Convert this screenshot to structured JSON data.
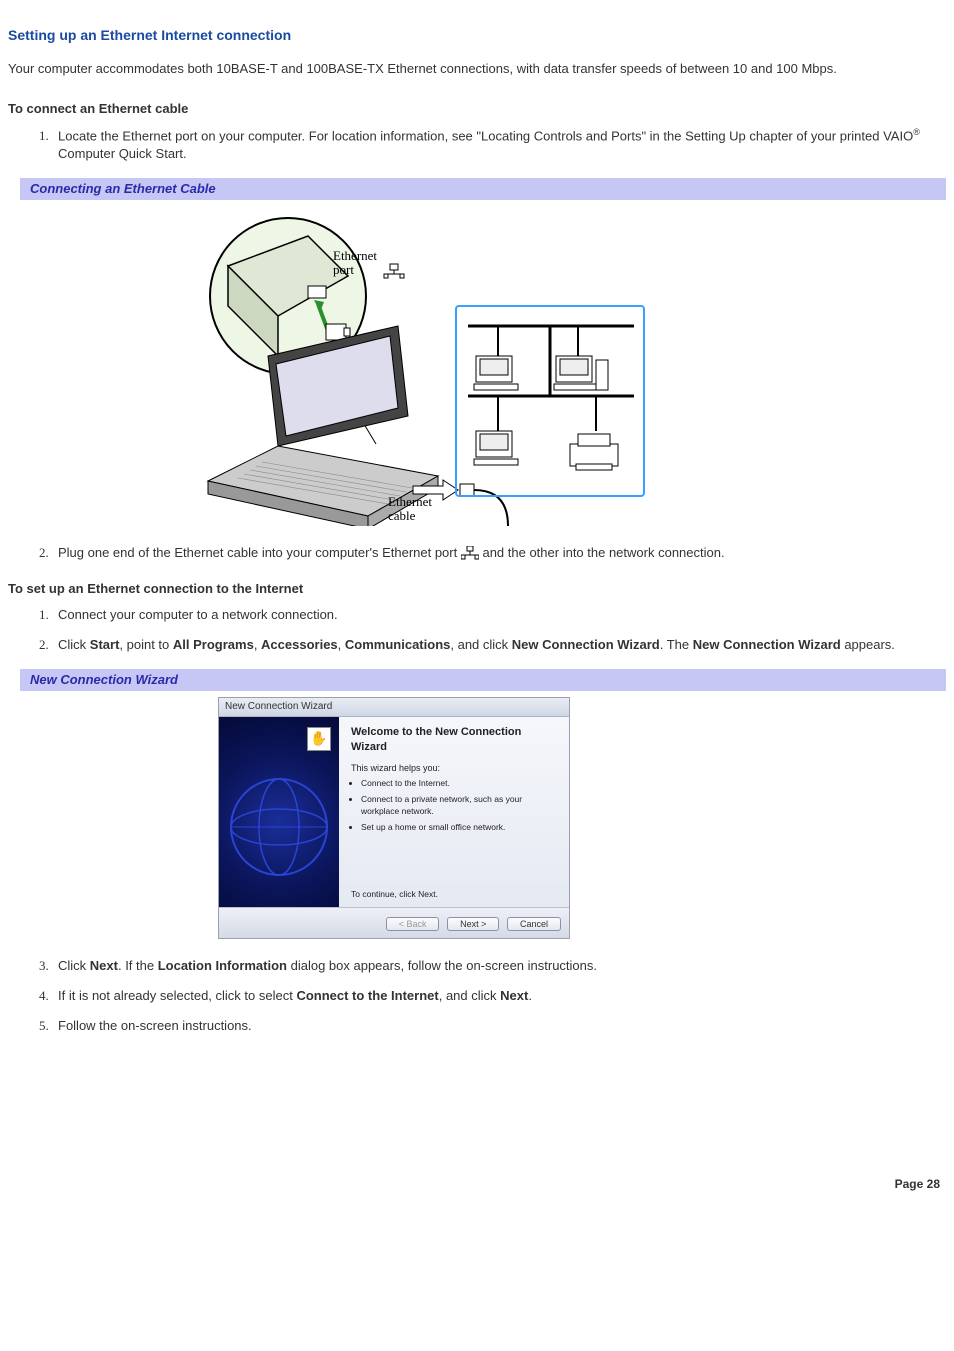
{
  "title": "Setting up an Ethernet Internet connection",
  "intro": "Your computer accommodates both 10BASE-T and 100BASE-TX Ethernet connections, with data transfer speeds of between 10 and 100 Mbps.",
  "section1": {
    "heading": "To connect an Ethernet cable",
    "step1_a": "Locate the Ethernet port on your computer. For location information, see \"Locating Controls and Ports\" in the Setting Up chapter of your printed VAIO",
    "step1_tm": "®",
    "step1_b": " Computer Quick Start.",
    "caption": "Connecting an Ethernet Cable",
    "diagram_labels": {
      "port": "Ethernet port",
      "cable": "Ethernet cable"
    },
    "step2_a": "Plug one end of the Ethernet cable into your computer's Ethernet port ",
    "step2_b": " and the other into the network connection."
  },
  "section2": {
    "heading": "To set up an Ethernet connection to the Internet",
    "step1": "Connect your computer to a network connection.",
    "step2": {
      "a": "Click ",
      "start": "Start",
      "b": ", point to ",
      "allprograms": "All Programs",
      "c": ", ",
      "accessories": "Accessories",
      "d": ", ",
      "communications": "Communications",
      "e": ", and click ",
      "ncw": "New Connection Wizard",
      "f": ". The ",
      "ncw2": "New Connection Wizard",
      "g": " appears."
    },
    "caption": "New Connection Wizard",
    "wizard": {
      "titlebar": "New Connection Wizard",
      "welcome": "Welcome to the New Connection Wizard",
      "helps": "This wizard helps you:",
      "bullet1": "Connect to the Internet.",
      "bullet2": "Connect to a private network, such as your workplace network.",
      "bullet3": "Set up a home or small office network.",
      "continue": "To continue, click Next.",
      "back": "< Back",
      "next": "Next >",
      "cancel": "Cancel"
    },
    "step3": {
      "a": "Click ",
      "next": "Next",
      "b": ". If the ",
      "locinfo": "Location Information",
      "c": " dialog box appears, follow the on-screen instructions."
    },
    "step4": {
      "a": "If it is not already selected, click to select ",
      "connect": "Connect to the Internet",
      "b": ", and click ",
      "next": "Next",
      "c": "."
    },
    "step5": "Follow the on-screen instructions."
  },
  "page_number": "Page 28"
}
